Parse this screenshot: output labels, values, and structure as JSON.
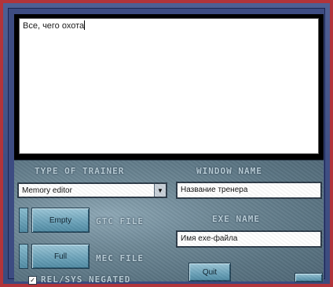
{
  "editor": {
    "text": "Все, чего охота"
  },
  "trainer": {
    "type_label": "TYPE OF TRAINER",
    "type_value": "Memory editor",
    "window_label": "WINDOW NAME",
    "window_value": "Название тренера",
    "exe_label": "EXE NAME",
    "exe_value": "Имя exe-файла",
    "empty_button": "Empty",
    "full_button": "Full",
    "gtc_label": "GTC FILE",
    "mec_label": "MEC FILE",
    "checkbox_label": "REL/SYS NEGATED",
    "checkbox_checked": true,
    "quit_button": "Quit"
  }
}
